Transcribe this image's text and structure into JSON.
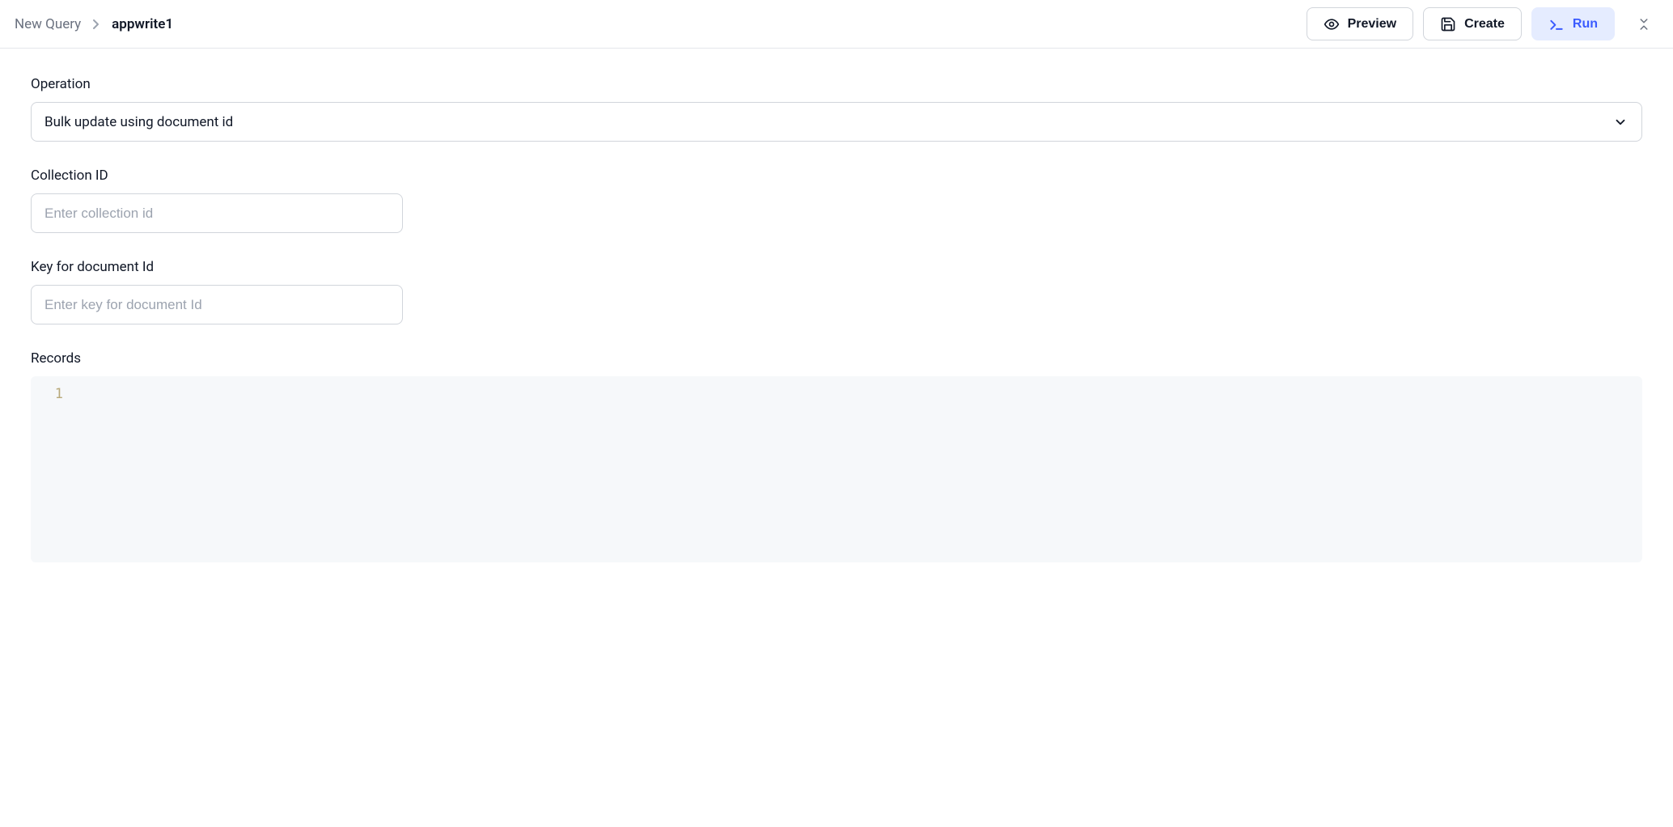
{
  "breadcrumb": {
    "root": "New Query",
    "current": "appwrite1"
  },
  "actions": {
    "preview": "Preview",
    "create": "Create",
    "run": "Run"
  },
  "form": {
    "operation": {
      "label": "Operation",
      "value": "Bulk update using document id"
    },
    "collection_id": {
      "label": "Collection ID",
      "placeholder": "Enter collection id",
      "value": ""
    },
    "document_key": {
      "label": "Key for document Id",
      "placeholder": "Enter key for document Id",
      "value": ""
    },
    "records": {
      "label": "Records",
      "line_number": "1",
      "content": ""
    }
  }
}
